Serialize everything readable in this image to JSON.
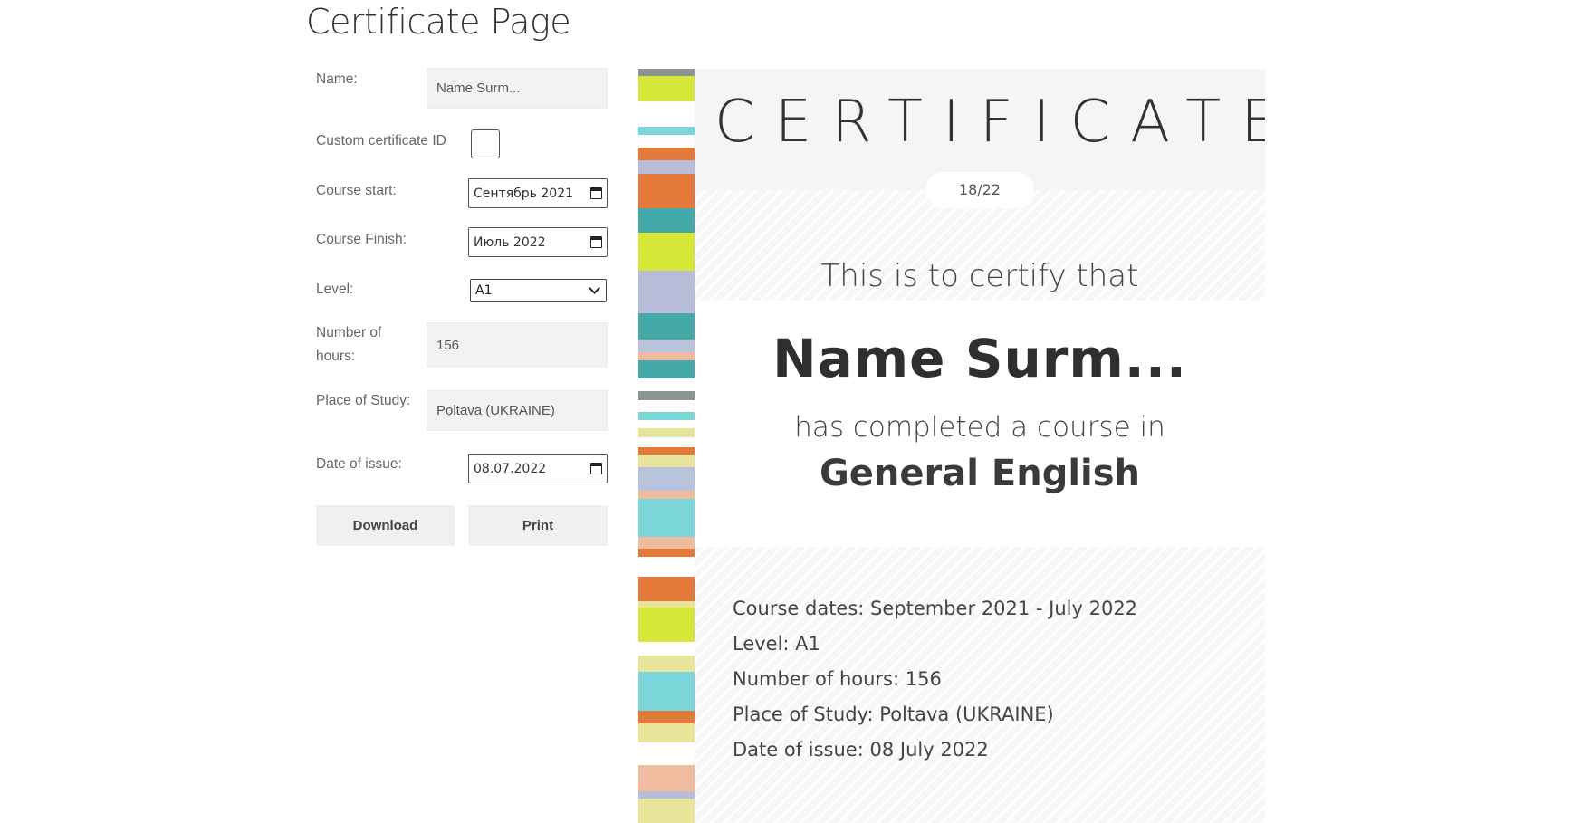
{
  "page": {
    "title": "Certificate Page"
  },
  "form": {
    "name_label": "Name:",
    "name_value": "Name Surm...",
    "custom_id_label": "Custom certificate ID",
    "course_start_label": "Course start:",
    "course_start_value": "Сентябрь 2021",
    "course_finish_label": "Course Finish:",
    "course_finish_value": "Июль 2022",
    "level_label": "Level:",
    "level_value": "A1",
    "hours_label_line1": "Number of",
    "hours_label_line2": "hours:",
    "hours_value": "156",
    "place_label": "Place of Study:",
    "place_value": "Poltava (UKRAINE)",
    "date_label": "Date of issue:",
    "date_value": "08.07.2022",
    "download_label": "Download",
    "print_label": "Print"
  },
  "stripes": [
    {
      "h": 8,
      "c": "#8c9494"
    },
    {
      "h": 28,
      "c": "#d5e83a"
    },
    {
      "h": 28,
      "c": "#ffffff"
    },
    {
      "h": 9,
      "c": "#7ad6d9"
    },
    {
      "h": 14,
      "c": "#ffffff"
    },
    {
      "h": 14,
      "c": "#e47a3a"
    },
    {
      "h": 15,
      "c": "#b7bcd8"
    },
    {
      "h": 38,
      "c": "#e47a3a"
    },
    {
      "h": 27,
      "c": "#45a9a9"
    },
    {
      "h": 42,
      "c": "#d5e83a"
    },
    {
      "h": 47,
      "c": "#b7bcd8"
    },
    {
      "h": 29,
      "c": "#45a9a9"
    },
    {
      "h": 14,
      "c": "#b7c4dc"
    },
    {
      "h": 9,
      "c": "#f0bca0"
    },
    {
      "h": 20,
      "c": "#45a9a9"
    },
    {
      "h": 14,
      "c": "#ffffff"
    },
    {
      "h": 10,
      "c": "#8c9494"
    },
    {
      "h": 13,
      "c": "#ffffff"
    },
    {
      "h": 9,
      "c": "#7ad6d9"
    },
    {
      "h": 9,
      "c": "#ffffff"
    },
    {
      "h": 10,
      "c": "#e8e49a"
    },
    {
      "h": 11,
      "c": "#ffffff"
    },
    {
      "h": 8,
      "c": "#e47a3a"
    },
    {
      "h": 14,
      "c": "#e8e49a"
    },
    {
      "h": 26,
      "c": "#b7c4dc"
    },
    {
      "h": 9,
      "c": "#f0bca0"
    },
    {
      "h": 42,
      "c": "#7ad6d9"
    },
    {
      "h": 13,
      "c": "#f0bca0"
    },
    {
      "h": 9,
      "c": "#e47a3a"
    },
    {
      "h": 22,
      "c": "#ffffff"
    },
    {
      "h": 27,
      "c": "#e47a3a"
    },
    {
      "h": 7,
      "c": "#e8e49a"
    },
    {
      "h": 38,
      "c": "#d5e83a"
    },
    {
      "h": 15,
      "c": "#ffffff"
    },
    {
      "h": 18,
      "c": "#e8e49a"
    },
    {
      "h": 43,
      "c": "#7ad6d9"
    },
    {
      "h": 14,
      "c": "#e47a3a"
    },
    {
      "h": 21,
      "c": "#e8e49a"
    },
    {
      "h": 25,
      "c": "#ffffff"
    },
    {
      "h": 29,
      "c": "#f0bca0"
    },
    {
      "h": 8,
      "c": "#b7bcd8"
    },
    {
      "h": 40,
      "c": "#e8e49a"
    }
  ],
  "certificate": {
    "title": "CERTIFICATE",
    "id": "18/22",
    "certify_line": "This is to certify that",
    "recipient_name": "Name Surm...",
    "completed_line": "has completed a course in",
    "course_name": "General English",
    "details": {
      "course_dates": "Course dates: September 2021 - July 2022",
      "level": "Level: A1",
      "hours": "Number of hours: 156",
      "place": "Place of Study: Poltava (UKRAINE)",
      "date": "Date of issue: 08 July 2022"
    }
  }
}
